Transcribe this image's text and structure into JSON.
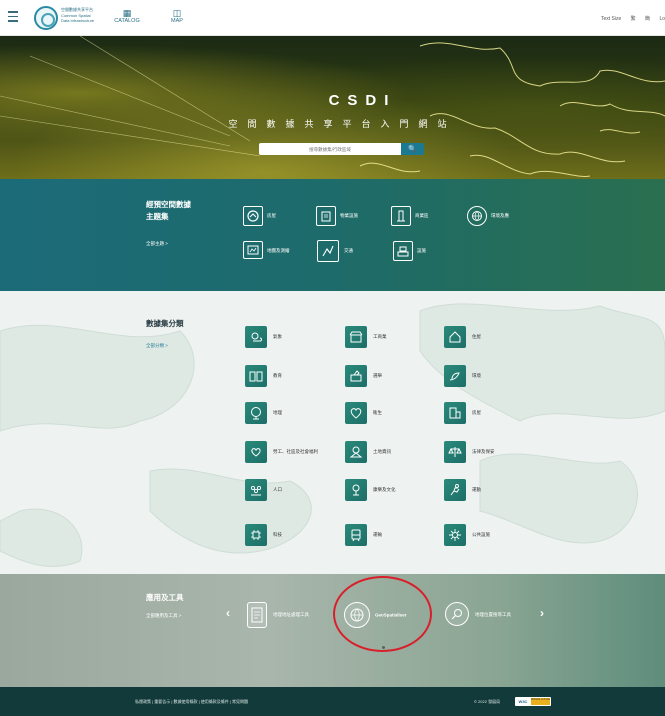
{
  "header": {
    "logo_lines": [
      "空間數據共享平台",
      "Common Spatial",
      "Data Infrastructure"
    ],
    "nav": [
      {
        "icon": "grid-icon",
        "label": "CATALOG"
      },
      {
        "icon": "map-icon",
        "label": "MAP"
      }
    ],
    "right_links": [
      "Text Size",
      "繁",
      "簡",
      "Lo"
    ]
  },
  "hero": {
    "title": "CSDI",
    "subtitle": "空間數據共享平台入門網站",
    "search_placeholder": "搜尋數據集/行政區域",
    "search_button_icon": "search-icon"
  },
  "themes": {
    "title_line1": "經預空間數據",
    "title_line2": "主題集",
    "view_all": "全部主題 >",
    "items": [
      {
        "icon": "housing-icon",
        "label": "房屋"
      },
      {
        "icon": "building-icon",
        "label": "物業設施"
      },
      {
        "icon": "tower-icon",
        "label": "商業區"
      },
      {
        "icon": "globe-icon",
        "label": "環境及應"
      },
      {
        "icon": "map-board-icon",
        "label": "地圖及測繪"
      },
      {
        "icon": "route-icon",
        "label": "交通"
      },
      {
        "icon": "facility-icon",
        "label": "設施"
      }
    ]
  },
  "categories": {
    "title": "數據集分類",
    "view_all": "全部分類 >",
    "items": [
      {
        "icon": "weather-icon",
        "label": "氣象"
      },
      {
        "icon": "shop-icon",
        "label": "工商業"
      },
      {
        "icon": "housing-icon",
        "label": "住屋"
      },
      {
        "icon": "book-icon",
        "label": "教育"
      },
      {
        "icon": "ballot-icon",
        "label": "選舉"
      },
      {
        "icon": "environment-icon",
        "label": "環境"
      },
      {
        "icon": "globe-icon",
        "label": "地理"
      },
      {
        "icon": "health-icon",
        "label": "衞生"
      },
      {
        "icon": "building-icon",
        "label": "房屋"
      },
      {
        "icon": "welfare-icon",
        "label": "勞工、社區及社會福利"
      },
      {
        "icon": "land-icon",
        "label": "土地資訊"
      },
      {
        "icon": "law-icon",
        "label": "法律及保安"
      },
      {
        "icon": "population-icon",
        "label": "人口"
      },
      {
        "icon": "recreation-icon",
        "label": "康樂及文化"
      },
      {
        "icon": "sports-icon",
        "label": "運動"
      },
      {
        "icon": "technology-icon",
        "label": "科技"
      },
      {
        "icon": "transport-icon",
        "label": "運輸"
      },
      {
        "icon": "utility-icon",
        "label": "公共設施"
      }
    ]
  },
  "apps": {
    "title": "應用及工具",
    "view_all": "全部應用及工具 >",
    "prev_icon": "chevron-left-icon",
    "next_icon": "chevron-right-icon",
    "items": [
      {
        "icon": "address-tool-icon",
        "label": "地理地址處理工具"
      },
      {
        "icon": "globe-icon",
        "label": "GeoSpatialiser"
      },
      {
        "icon": "location-search-icon",
        "label": "地理位置搜尋工具"
      }
    ]
  },
  "footer": {
    "links": "私隱政策 | 重要告示 | 數據使用條款 | 使用條款及條件 | 常見問題",
    "copyright": "© 2022 發展局",
    "badge_left": "W3C",
    "badge_right": "WCAG 2.0 AA"
  },
  "colors": {
    "teal": "#1c6b79",
    "tile_green": "#2a8a7a",
    "footer": "#123a3a",
    "highlight_circle": "#d8202b"
  }
}
